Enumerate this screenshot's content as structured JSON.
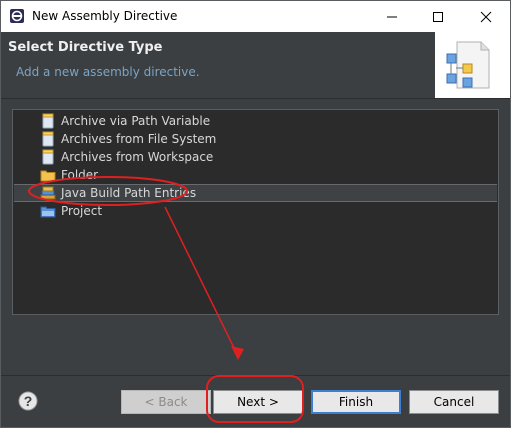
{
  "window": {
    "title": "New Assembly Directive",
    "minimize_icon": "minimize-icon",
    "maximize_icon": "maximize-icon",
    "close_icon": "close-icon"
  },
  "header": {
    "title": "Select Directive Type",
    "subtitle": "Add a new assembly directive.",
    "banner_icon": "assembly-directive-wizard-icon"
  },
  "tree": {
    "items": [
      {
        "label": "Archive via Path Variable",
        "icon": "jar-icon",
        "selected": false
      },
      {
        "label": "Archives from File System",
        "icon": "jar-icon",
        "selected": false
      },
      {
        "label": "Archives from Workspace",
        "icon": "jar-icon",
        "selected": false
      },
      {
        "label": "Folder",
        "icon": "folder-icon",
        "selected": false
      },
      {
        "label": "Java Build Path Entries",
        "icon": "library-icon",
        "selected": true
      },
      {
        "label": "Project",
        "icon": "project-folder-icon",
        "selected": false
      }
    ]
  },
  "buttons": {
    "help_icon": "help-icon",
    "back": "< Back",
    "next": "Next >",
    "finish": "Finish",
    "cancel": "Cancel"
  },
  "colors": {
    "dialog_bg": "#3b3f42",
    "tree_bg": "#2b2b2b",
    "subtitle": "#7aa4c6",
    "annotation_red": "#e02020",
    "default_button_border": "#3c7fd1"
  }
}
